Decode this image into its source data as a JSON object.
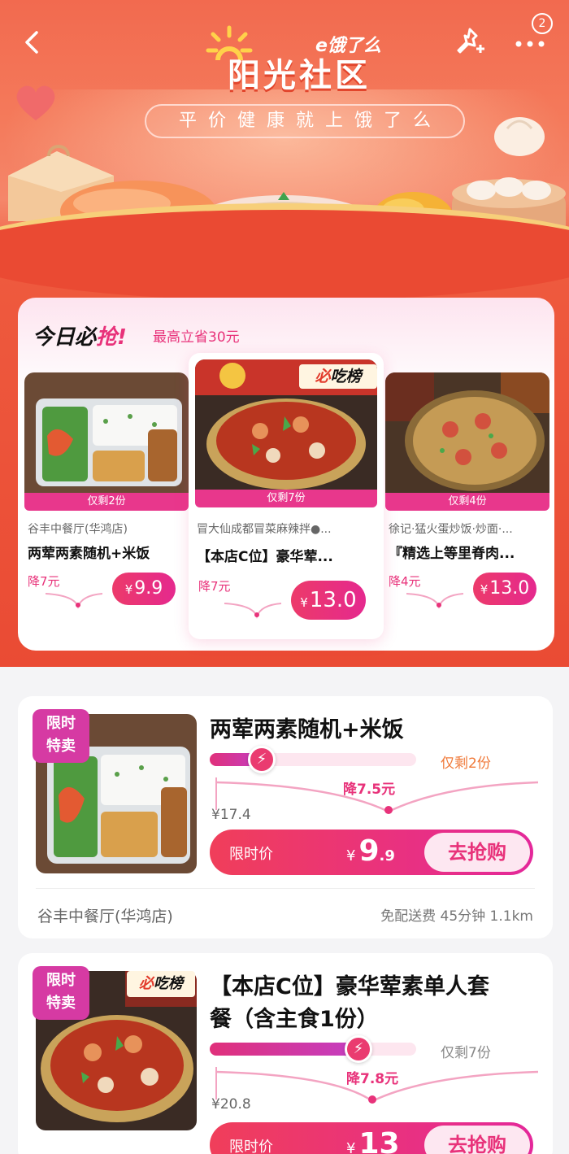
{
  "header": {
    "brand": "e饿了么",
    "title": "阳光社区",
    "slogan": "平价健康就上饿了么",
    "badge_count": "2"
  },
  "deals": {
    "title_prefix": "今日必",
    "title_accent": "抢!",
    "subtitle": "最高立省30元",
    "hot_tag_prefix": "必",
    "hot_tag_suffix": "吃榜",
    "items": [
      {
        "shop": "谷丰中餐厅(华鸿店)",
        "name": "两荤两素随机+米饭",
        "left": "仅剩2份",
        "off": "降7元",
        "currency": "¥",
        "price": "9.9"
      },
      {
        "shop": "冒大仙成都冒菜麻辣拌●...",
        "name": "【本店C位】豪华荤...",
        "left": "仅剩7份",
        "off": "降7元",
        "currency": "¥",
        "price": "13.0"
      },
      {
        "shop": "徐记·猛火蛋炒饭·炒面·...",
        "name": "『精选上等里脊肉...",
        "left": "仅剩4份",
        "off": "降4元",
        "currency": "¥",
        "price": "13.0"
      }
    ]
  },
  "products": [
    {
      "flash_tag_1": "限时",
      "flash_tag_2": "特卖",
      "title": "两荤两素随机+米饭",
      "stock": "仅剩2份",
      "original_price": "¥17.4",
      "drop": "降7.5元",
      "buy_label": "限时价",
      "currency": "¥",
      "price_int": "9",
      "price_dec": ".9",
      "buy_button": "去抢购",
      "shop": "谷丰中餐厅(华鸿店)",
      "delivery": "免配送费 45分钟 1.1km",
      "sold_fraction": 0.25
    },
    {
      "flash_tag_1": "限时",
      "flash_tag_2": "特卖",
      "hot_tag_prefix": "必",
      "hot_tag_suffix": "吃榜",
      "title_line1": "【本店C位】豪华荤素单人套",
      "title_line2": "餐（含主食1份）",
      "stock": "仅剩7份",
      "original_price": "¥20.8",
      "drop": "降7.8元",
      "buy_label": "限时价",
      "currency": "¥",
      "price_int": "13",
      "price_dec": "",
      "buy_button": "去抢购",
      "sold_fraction": 0.72
    }
  ],
  "colors": {
    "accent": "#e8327a",
    "hero": "#ee5a3e",
    "stock_orange": "#f07a3a",
    "stock_gray": "#888888"
  }
}
